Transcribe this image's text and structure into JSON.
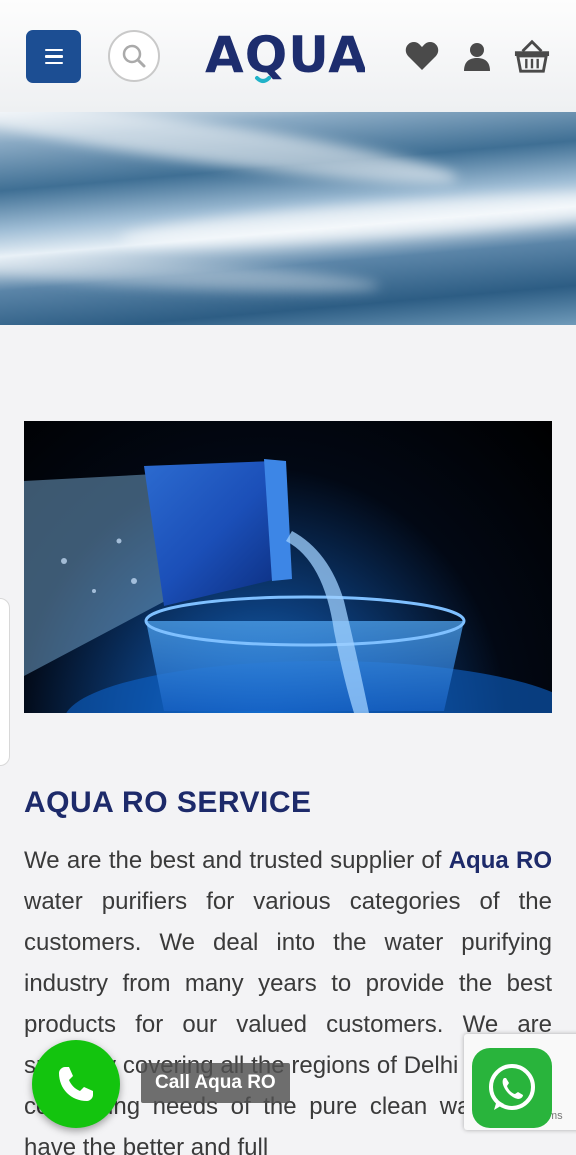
{
  "header": {
    "logo_text": "AQUA",
    "icons": {
      "menu": "menu-icon",
      "search": "search-icon",
      "wishlist": "heart-icon",
      "account": "user-icon",
      "cart": "basket-icon"
    }
  },
  "section": {
    "title": "AQUA RO SERVICE",
    "brand_highlight": "Aqua RO",
    "text_before": "We are the best and trusted supplier of ",
    "text_after": " water purifiers for various categories of the customers. We deal into the water purifying industry from many years to provide the best products for our valued customers. We are specially covering all the regions of Delhi NCR for completing needs of the pure clean water. We have the better and full"
  },
  "floating": {
    "call_label": "Call Aqua RO",
    "recaptcha_terms": "ms",
    "colors": {
      "call": "#13c40e",
      "whatsapp": "#29b43c"
    }
  },
  "theme": {
    "primary": "#1c4e93",
    "heading": "#1d2a6a"
  }
}
